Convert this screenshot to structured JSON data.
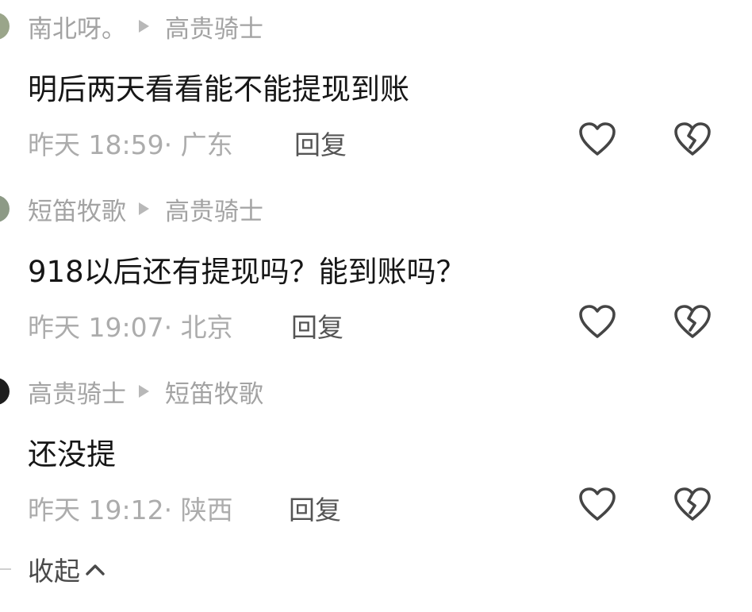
{
  "comments": [
    {
      "author": "南北呀。",
      "reply_to": "高贵骑士",
      "text": "明后两天看看能不能提现到账",
      "time": "昨天 18:59",
      "location": "· 广东",
      "reply_label": "回复"
    },
    {
      "author": "短笛牧歌",
      "reply_to": "高贵骑士",
      "text": "918以后还有提现吗？能到账吗？",
      "time": "昨天 19:07",
      "location": "· 北京",
      "reply_label": "回复"
    },
    {
      "author": "高贵骑士",
      "reply_to": "短笛牧歌",
      "text": "还没提",
      "time": "昨天 19:12",
      "location": "· 陕西",
      "reply_label": "回复"
    }
  ],
  "collapse_label": "收起",
  "colors": {
    "icon": "#454545",
    "meta": "#acacac",
    "text": "#161616"
  }
}
